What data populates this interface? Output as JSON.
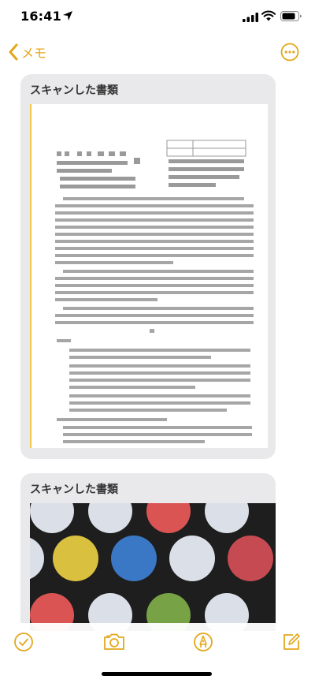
{
  "status_bar": {
    "time": "16:41",
    "location_icon": "location-arrow-icon",
    "signal_icon": "cellular-signal-icon",
    "wifi_icon": "wifi-icon",
    "battery_icon": "battery-icon"
  },
  "nav": {
    "back_label": "メモ",
    "back_icon": "chevron-left-icon",
    "more_icon": "ellipsis-circle-icon"
  },
  "attachments": [
    {
      "title": "スキャンした書類",
      "content": "scanned-text-document"
    },
    {
      "title": "スキャンした書類",
      "content": "scanned-polka-dot-photo"
    }
  ],
  "toolbar": {
    "checklist_icon": "checkmark-circle-icon",
    "camera_icon": "camera-icon",
    "markup_icon": "pen-circle-icon",
    "compose_icon": "compose-icon"
  },
  "colors": {
    "accent": "#e3a71b",
    "card_bg": "#e9e9eb",
    "dot_colors": [
      "#d9dde6",
      "#d94a4a",
      "#d8bd34",
      "#2e6fc2",
      "#6f9e3b",
      "#c23f47"
    ]
  }
}
